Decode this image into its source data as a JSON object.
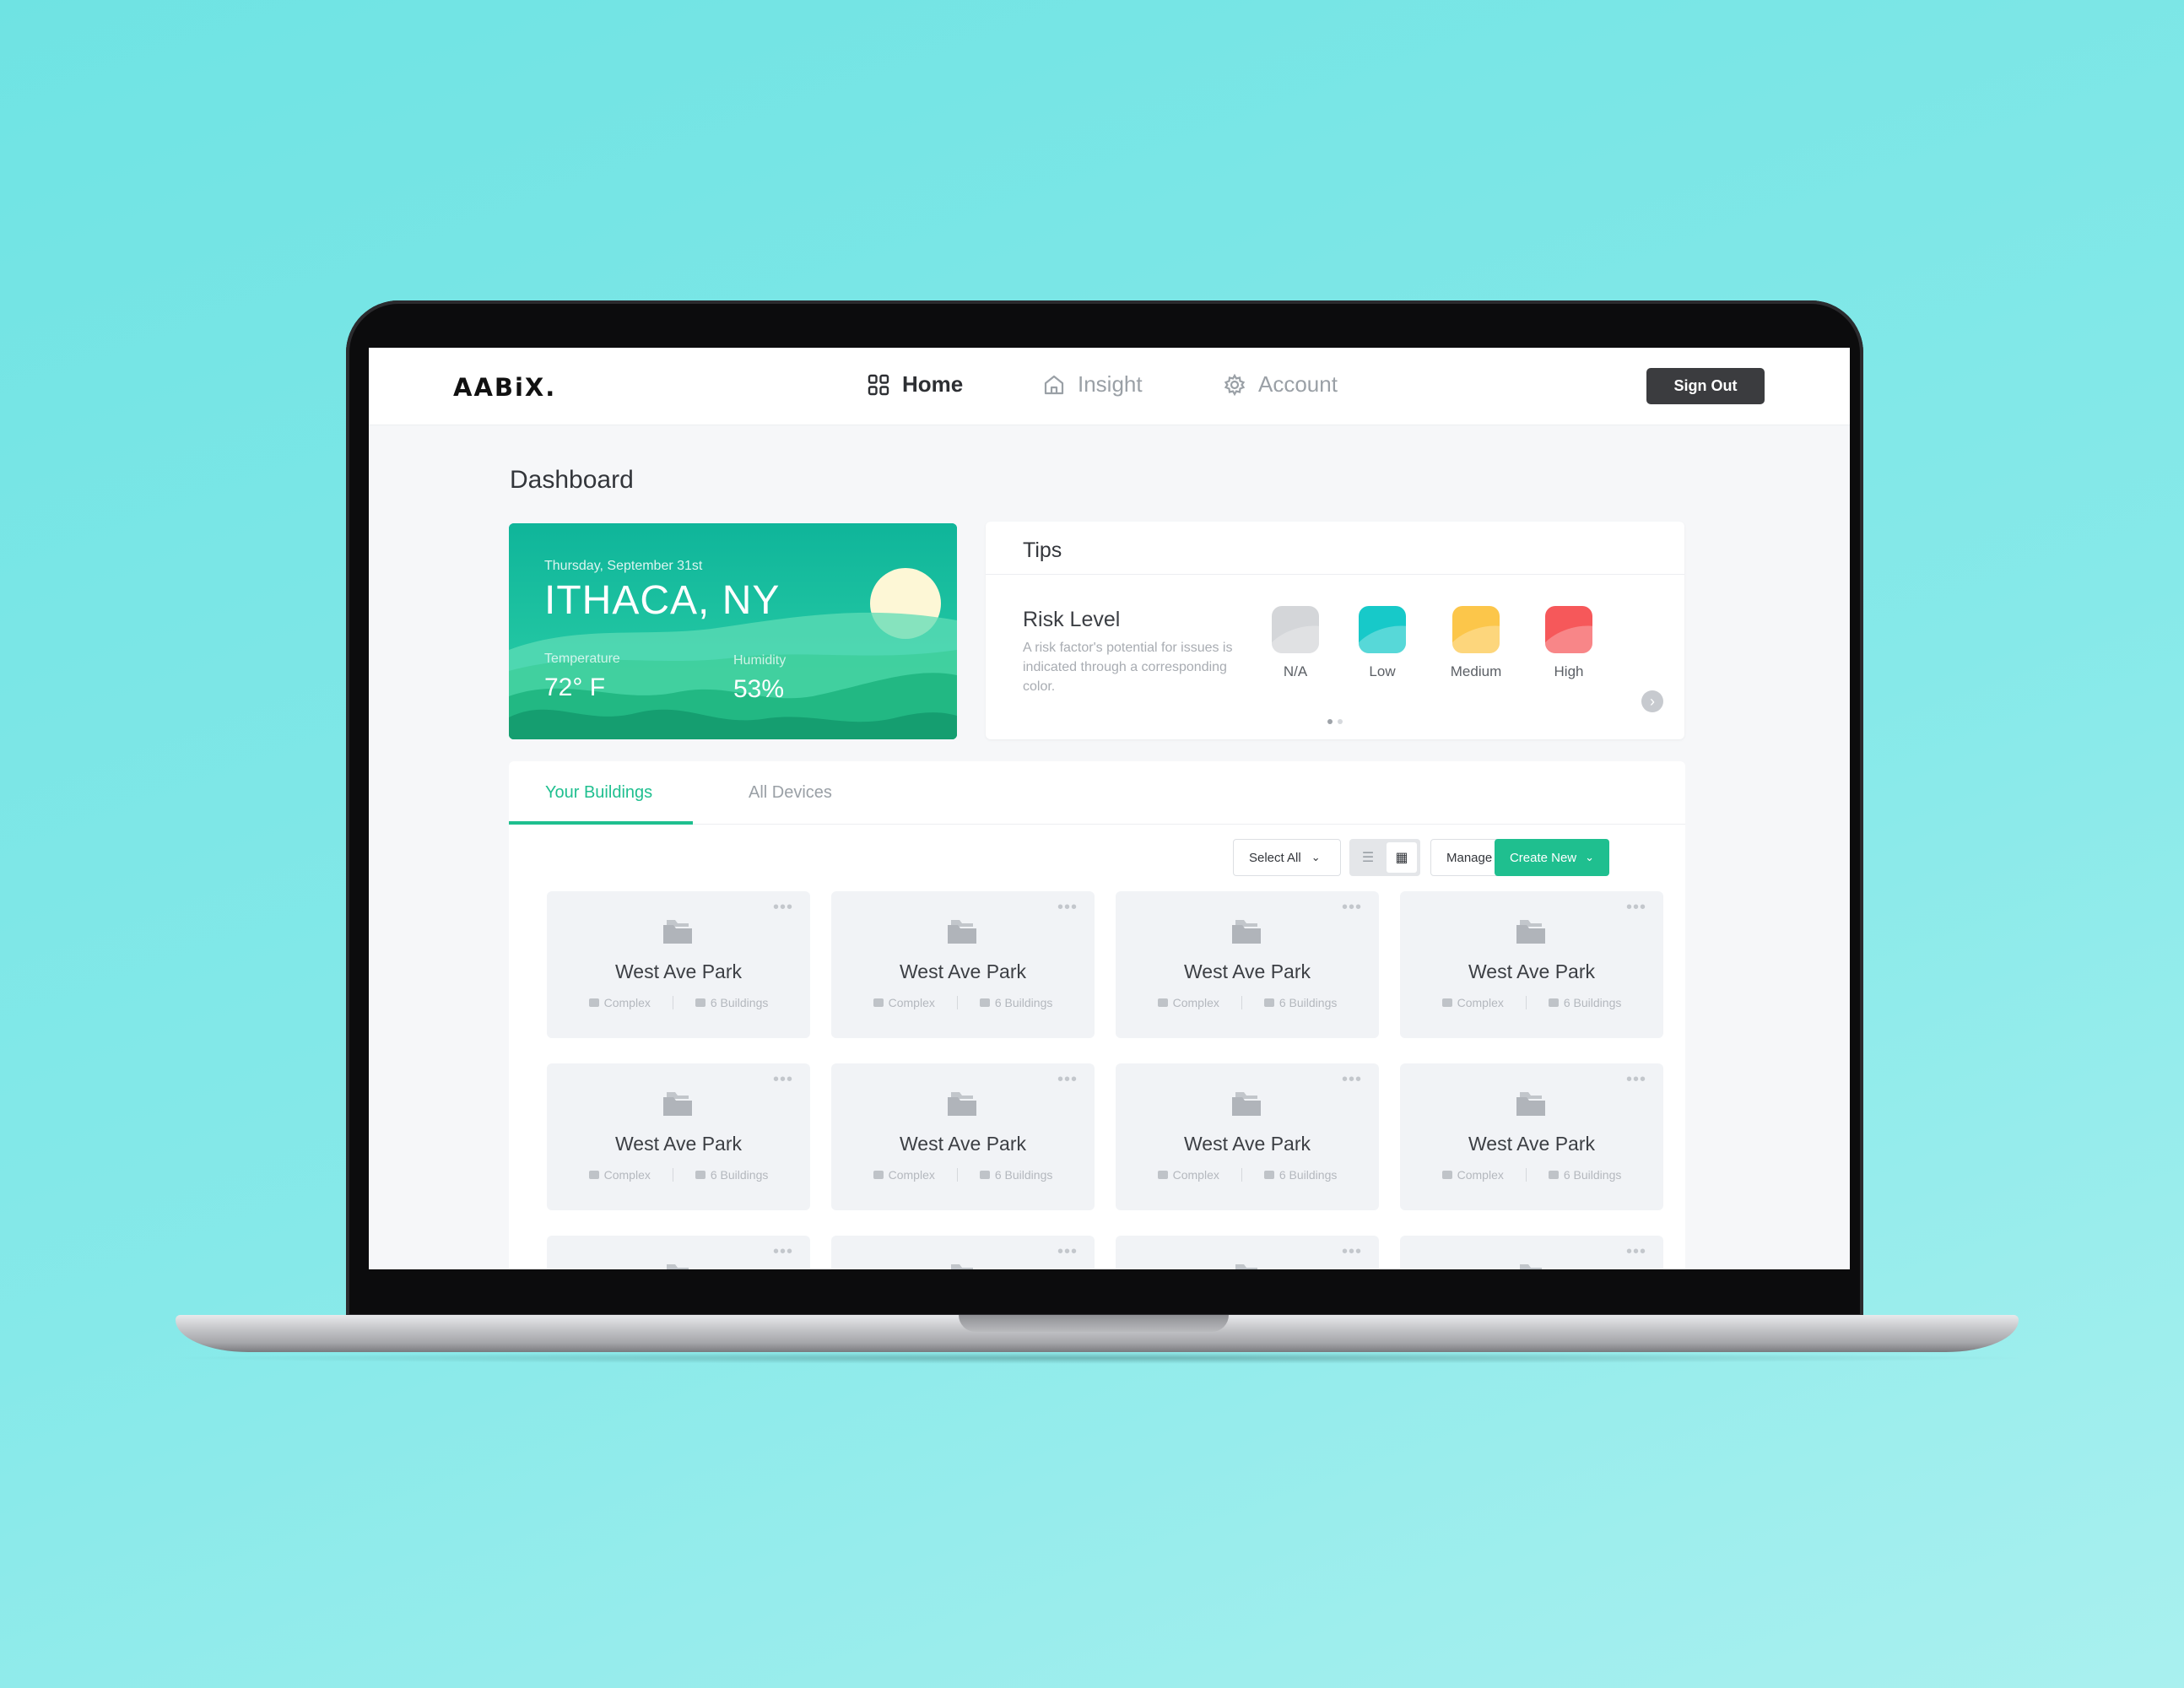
{
  "app": {
    "logo": "AABiX.",
    "nav": [
      {
        "label": "Home",
        "icon": "grid-icon",
        "active": true
      },
      {
        "label": "Insight",
        "icon": "house-icon",
        "active": false
      },
      {
        "label": "Account",
        "icon": "gear-icon",
        "active": false
      }
    ],
    "sign_out_label": "Sign Out"
  },
  "dashboard": {
    "title": "Dashboard",
    "weather": {
      "date": "Thursday, September 31st",
      "city": "ITHACA, NY",
      "temperature_label": "Temperature",
      "temperature_value": "72° F",
      "humidity_label": "Humidity",
      "humidity_value": "53%"
    },
    "tips": {
      "title": "Tips",
      "risk_title": "Risk Level",
      "risk_description": "A risk factor's potential for issues is indicated through a corresponding color.",
      "levels": [
        {
          "label": "N/A",
          "color": "#d4d6d9"
        },
        {
          "label": "Low",
          "color": "#17c9c9"
        },
        {
          "label": "Medium",
          "color": "#fcc64a"
        },
        {
          "label": "High",
          "color": "#f6585a"
        }
      ],
      "page_dots": 2,
      "active_dot": 0
    }
  },
  "buildings_panel": {
    "tabs": [
      {
        "label": "Your Buildings",
        "active": true
      },
      {
        "label": "All Devices",
        "active": false
      }
    ],
    "select_all_label": "Select All",
    "manage_label": "Manage",
    "create_new_label": "Create New",
    "accent_color": "#1fbf8f",
    "cards": [
      {
        "name": "West Ave Park",
        "type": "Complex",
        "buildings": "6 Buildings"
      },
      {
        "name": "West Ave Park",
        "type": "Complex",
        "buildings": "6 Buildings"
      },
      {
        "name": "West Ave Park",
        "type": "Complex",
        "buildings": "6 Buildings"
      },
      {
        "name": "West Ave Park",
        "type": "Complex",
        "buildings": "6 Buildings"
      },
      {
        "name": "West Ave Park",
        "type": "Complex",
        "buildings": "6 Buildings"
      },
      {
        "name": "West Ave Park",
        "type": "Complex",
        "buildings": "6 Buildings"
      },
      {
        "name": "West Ave Park",
        "type": "Complex",
        "buildings": "6 Buildings"
      },
      {
        "name": "West Ave Park",
        "type": "Complex",
        "buildings": "6 Buildings"
      }
    ]
  }
}
